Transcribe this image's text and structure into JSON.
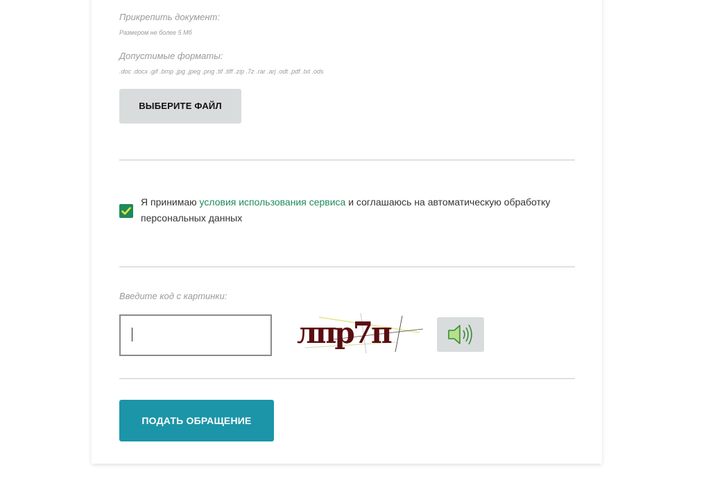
{
  "attachment": {
    "title": "Прикрепить документ:",
    "size_note": "Размером не более 5 Мб",
    "formats_title": "Допустимые форматы:",
    "formats_list": ".doc .docx .gif .bmp .jpg .jpeg .png .tif .tiff .zip .7z .rar .arj .odt .pdf .txt .ods",
    "choose_file_label": "ВЫБЕРИТЕ ФАЙЛ"
  },
  "consent": {
    "checked": true,
    "text_before": "Я принимаю ",
    "link_text": "условия использования сервиса",
    "text_after": " и соглашаюсь на автоматическую обработку персональных данных"
  },
  "captcha": {
    "label": "Введите код с картинки:",
    "input_value": "",
    "image_text": "лпр7п"
  },
  "submit": {
    "label": "ПОДАТЬ ОБРАЩЕНИЕ"
  },
  "colors": {
    "accent_green": "#1e8a5a",
    "submit_teal": "#1c95a8",
    "button_gray": "#d9dcdc"
  }
}
